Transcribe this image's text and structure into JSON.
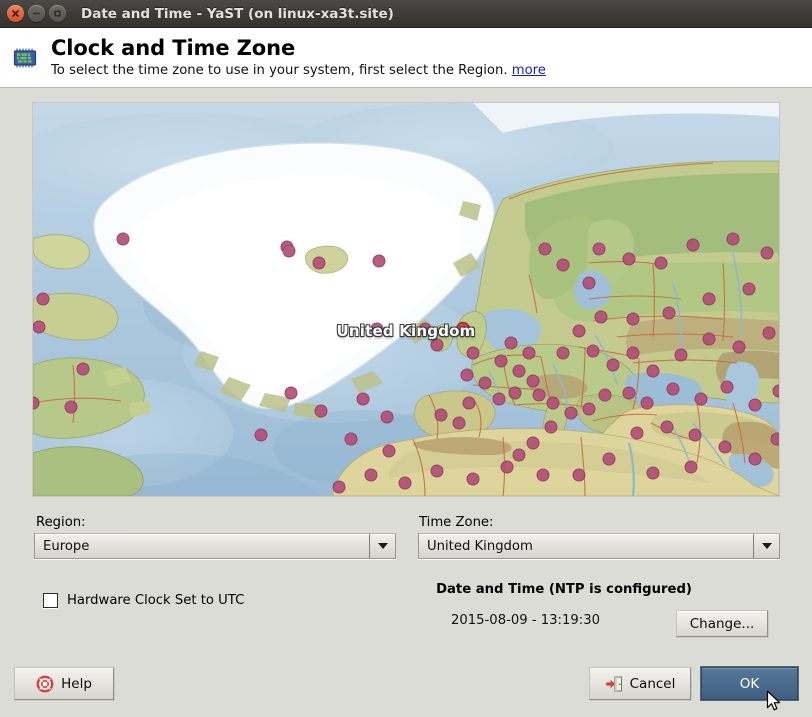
{
  "window": {
    "title": "Date and Time - YaST (on linux-xa3t.site)",
    "controls": {
      "close_icon": "close-icon",
      "minimize_icon": "minimize-icon",
      "maximize_icon": "maximize-icon"
    }
  },
  "header": {
    "icon": "chip-clock-icon",
    "title": "Clock and Time Zone",
    "subtitle": "To select the time zone to use in your system, first select the Region.",
    "more_link": "more"
  },
  "map": {
    "selected_label": "United Kingdom",
    "selected_marker_color": "#e03c3c",
    "marker_color": "#b44e78",
    "ocean_color": "#aec6dd",
    "land_color": "#c9cf94",
    "ice_color": "#fbfcfd",
    "desert_color": "#ddd59b",
    "border_color": "#c76a3c"
  },
  "region": {
    "label": "Region:",
    "value": "Europe"
  },
  "timezone": {
    "label": "Time Zone:",
    "value": "United Kingdom"
  },
  "hardware_clock": {
    "label": "Hardware Clock Set to UTC",
    "checked": false
  },
  "datetime": {
    "title": "Date and Time (NTP is configured)",
    "value": "2015-08-09 - 13:19:30",
    "change_label": "Change..."
  },
  "buttons": {
    "help": {
      "label": "Help",
      "icon": "lifebuoy-icon"
    },
    "cancel": {
      "label": "Cancel",
      "icon": "exit-door-icon"
    },
    "ok": {
      "label": "OK",
      "accent_color": "#4c6c8e"
    }
  },
  "cursor": {
    "icon": "arrow-pointer-icon"
  }
}
